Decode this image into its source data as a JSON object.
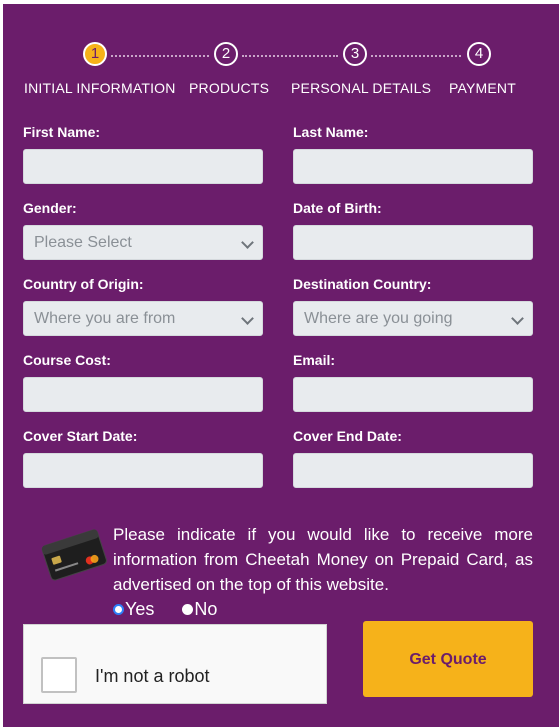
{
  "steps": [
    {
      "number": "1",
      "label": "INITIAL INFORMATION"
    },
    {
      "number": "2",
      "label": "PRODUCTS"
    },
    {
      "number": "3",
      "label": "PERSONAL DETAILS"
    },
    {
      "number": "4",
      "label": "PAYMENT"
    }
  ],
  "form": {
    "first_name_label": "First Name:",
    "last_name_label": "Last Name:",
    "gender_label": "Gender:",
    "gender_value": "Please Select",
    "dob_label": "Date of Birth:",
    "origin_label": "Country of Origin:",
    "origin_value": "Where you are from",
    "destination_label": "Destination Country:",
    "destination_value": "Where are you going",
    "course_cost_label": "Course Cost:",
    "email_label": "Email:",
    "cover_start_label": "Cover Start Date:",
    "cover_end_label": "Cover End Date:"
  },
  "promo": {
    "text": "Please indicate if you would like to receive more information from Cheetah Money on Prepaid Card, as advertised on the top of this website.",
    "yes_label": "Yes",
    "no_label": "No",
    "selected": "Yes"
  },
  "recaptcha": {
    "label": "I'm not a robot"
  },
  "submit": {
    "label": "Get Quote"
  },
  "colors": {
    "background": "#6b1d6b",
    "accent": "#f6b21a",
    "input": "#e8ebee"
  }
}
